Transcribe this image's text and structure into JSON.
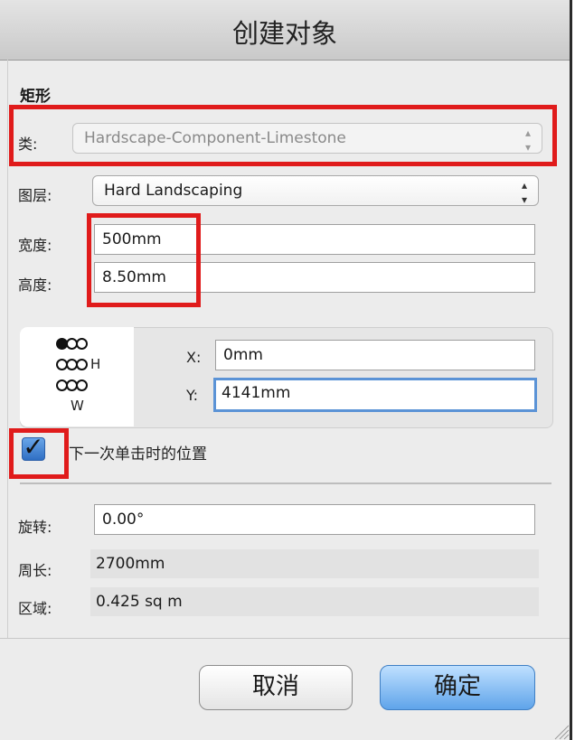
{
  "dialog": {
    "title": "创建对象",
    "section_title": "矩形",
    "class": {
      "label": "类:",
      "value": "Hardscape-Component-Limestone"
    },
    "layer": {
      "label": "图层:",
      "value": "Hard Landscaping"
    },
    "width": {
      "label": "宽度:",
      "value": "500mm"
    },
    "height": {
      "label": "高度:",
      "value": "8.50mm"
    },
    "anchor": {
      "h_label": "H",
      "w_label": "W"
    },
    "x": {
      "label": "X:",
      "value": "0mm"
    },
    "y": {
      "label": "Y:",
      "value": "4141mm"
    },
    "next_click_checkbox": {
      "label": "下一次单击时的位置",
      "checked": true
    },
    "rotation": {
      "label": "旋转:",
      "value": "0.00°"
    },
    "perimeter": {
      "label": "周长:",
      "value": "2700mm"
    },
    "area": {
      "label": "区域:",
      "value": "0.425 sq m"
    },
    "buttons": {
      "cancel": "取消",
      "ok": "确定"
    }
  },
  "colors": {
    "highlight_box": "#e01b1b",
    "ok_button": "#5fa4ea",
    "focus_ring": "#5b93d6"
  }
}
